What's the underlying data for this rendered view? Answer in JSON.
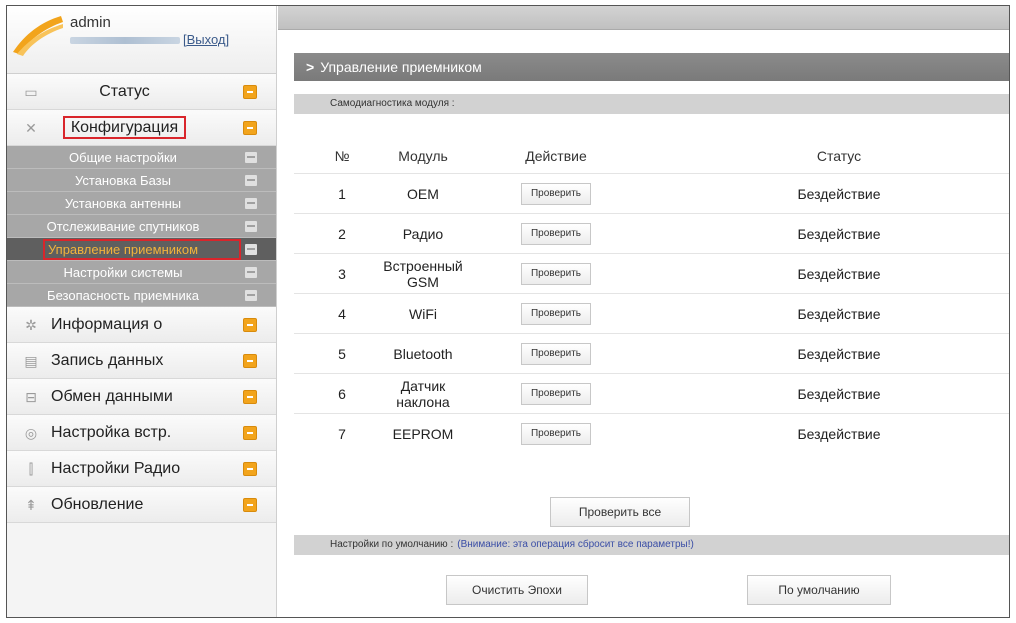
{
  "user": {
    "name": "admin",
    "logout": "[Выход]"
  },
  "sidebar": {
    "items": [
      {
        "label": "Статус",
        "icon": "monitor-icon"
      },
      {
        "label": "Конфигурация",
        "icon": "tools-icon"
      }
    ],
    "submenu": [
      {
        "label": "Общие настройки"
      },
      {
        "label": "Установка Базы"
      },
      {
        "label": "Установка антенны"
      },
      {
        "label": "Отслеживание спутников"
      },
      {
        "label": "Управление приемником"
      },
      {
        "label": "Настройки системы"
      },
      {
        "label": "Безопасность приемника"
      }
    ],
    "items_after": [
      {
        "label": "Информация о",
        "icon": "info-icon"
      },
      {
        "label": "Запись данных",
        "icon": "record-icon"
      },
      {
        "label": "Обмен данными",
        "icon": "exchange-icon"
      },
      {
        "label": "Настройка встр.",
        "icon": "settings-icon"
      },
      {
        "label": "Настройки Радио",
        "icon": "radio-icon"
      },
      {
        "label": "Обновление",
        "icon": "upload-icon"
      }
    ]
  },
  "main": {
    "header": "Управление приемником",
    "section_diag": "Самодиагностика модуля :",
    "table": {
      "columns": [
        "№",
        "Модуль",
        "Действие",
        "Статус"
      ],
      "rows": [
        {
          "num": "1",
          "module": "OEM",
          "action": "Проверить",
          "status": "Бездействие"
        },
        {
          "num": "2",
          "module": "Радио",
          "action": "Проверить",
          "status": "Бездействие"
        },
        {
          "num": "3",
          "module": "Встроенный GSM",
          "action": "Проверить",
          "status": "Бездействие"
        },
        {
          "num": "4",
          "module": "WiFi",
          "action": "Проверить",
          "status": "Бездействие"
        },
        {
          "num": "5",
          "module": "Bluetooth",
          "action": "Проверить",
          "status": "Бездействие"
        },
        {
          "num": "6",
          "module": "Датчик наклона",
          "action": "Проверить",
          "status": "Бездействие"
        },
        {
          "num": "7",
          "module": "EEPROM",
          "action": "Проверить",
          "status": "Бездействие"
        }
      ]
    },
    "check_all": "Проверить все",
    "section_default": "Настройки по умолчанию :",
    "warning": "(Внимание: эта операция сбросит все параметры!)",
    "clear_epochs": "Очистить Эпохи",
    "default_button": "По умолчанию"
  },
  "colors": {
    "accent_orange": "#f2a41c",
    "highlight_red": "#d9252b",
    "header_gray": "#8b8b8b"
  }
}
